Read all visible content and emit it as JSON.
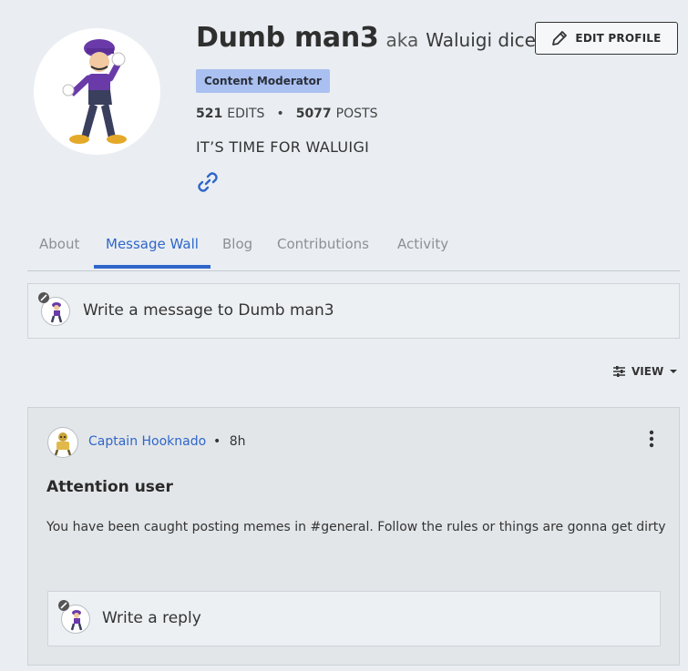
{
  "profile": {
    "username": "Dumb man3",
    "aka_label": "aka",
    "alias": "Waluigi dice",
    "role_badge": "Content Moderator",
    "edits_count": "521",
    "edits_label": "EDITS",
    "posts_count": "5077",
    "posts_label": "POSTS",
    "separator": "•",
    "bio": "IT’S TIME FOR WALUIGI",
    "avatar_icon": "waluigi-avatar-icon",
    "link_icon": "link-icon"
  },
  "actions": {
    "edit_profile_label": "EDIT PROFILE",
    "edit_icon": "pencil-icon"
  },
  "tabs": [
    {
      "label": "About"
    },
    {
      "label": "Message Wall"
    },
    {
      "label": "Blog"
    },
    {
      "label": "Contributions"
    },
    {
      "label": "Activity"
    }
  ],
  "active_tab": "Message Wall",
  "composer": {
    "placeholder": "Write a message to Dumb man3"
  },
  "view_control": {
    "label": "VIEW",
    "icon": "sliders-icon"
  },
  "post": {
    "author": "Captain Hooknado",
    "separator": "•",
    "time": "8h",
    "title": "Attention user",
    "body": "You have been caught posting memes in #general. Follow the rules or things are gonna get dirty",
    "reply_placeholder": "Write a reply"
  },
  "colors": {
    "accent": "#2f66c9",
    "badge": "#a9c0f0",
    "background": "#eaeef2",
    "waluigi_purple": "#6a3aa8"
  }
}
